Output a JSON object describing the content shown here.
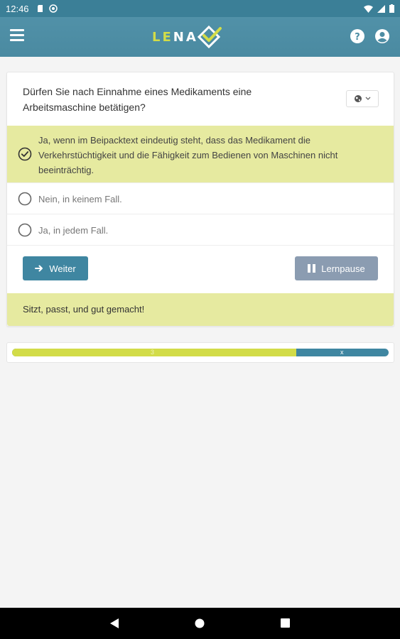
{
  "status_bar": {
    "time": "12:46"
  },
  "app": {
    "logo_le": "LE",
    "logo_na": "NA",
    "menu_icon": "hamburger-menu-icon",
    "help_icon": "help-circle-icon",
    "account_icon": "account-circle-icon"
  },
  "question": {
    "text": "Dürfen Sie nach Einnahme eines Medikaments eine Arbeitsmaschine betätigen?",
    "language_icon": "globe-icon"
  },
  "answers": [
    {
      "text": "Ja, wenn im Beipacktext eindeutig steht, dass das Medikament die Verkehrstüchtigkeit und die Fähigkeit zum Bedienen von Maschinen nicht beeinträchtig.",
      "selected": true
    },
    {
      "text": "Nein, in keinem Fall.",
      "selected": false
    },
    {
      "text": "Ja, in jedem Fall.",
      "selected": false
    }
  ],
  "buttons": {
    "next_label": "Weiter",
    "pause_label": "Lernpause"
  },
  "feedback": "Sitzt, passt, und gut gemacht!",
  "progress": {
    "done_label": "3",
    "rest_label": "x",
    "fraction": 0.755
  },
  "colors": {
    "primary": "#3f86a1",
    "accent": "#d2dc48",
    "highlight": "#e6eaa0",
    "secondary_button": "#8b9cb1"
  }
}
